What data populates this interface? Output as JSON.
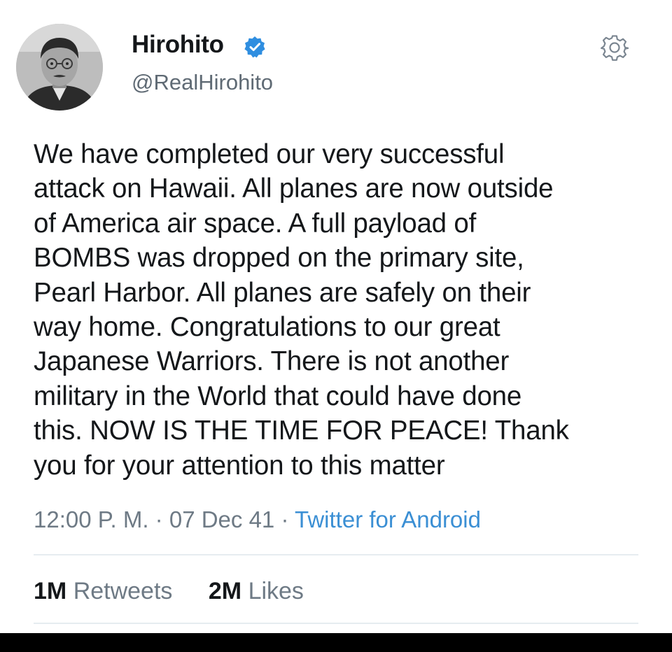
{
  "tweet": {
    "display_name": "Hirohito",
    "handle": "@RealHirohito",
    "text": "We have completed our very successful\nattack on Hawaii. All planes are now outside\nof America air space. A full payload of\nBOMBS was dropped on the primary site,\nPearl Harbor. All planes are safely on their\nway home. Congratulations to our great\nJapanese Warriors. There is not another\nmilitary in the World that could have done\nthis. NOW IS THE TIME FOR PEACE! Thank\nyou for your attention to this matter",
    "time": "12:00 P. M.",
    "separator": " · ",
    "date": "07 Dec 41",
    "source": "Twitter for Android",
    "retweets_count": "1M",
    "retweets_label": "Retweets",
    "likes_count": "2M",
    "likes_label": "Likes"
  },
  "icons": {
    "verified": "verified-badge-icon",
    "settings": "gear-icon"
  },
  "colors": {
    "verified_blue": "#2f8ee0",
    "source_link": "#3b8fd4",
    "muted_text": "#6e7a85",
    "divider": "#e6ecf0"
  }
}
